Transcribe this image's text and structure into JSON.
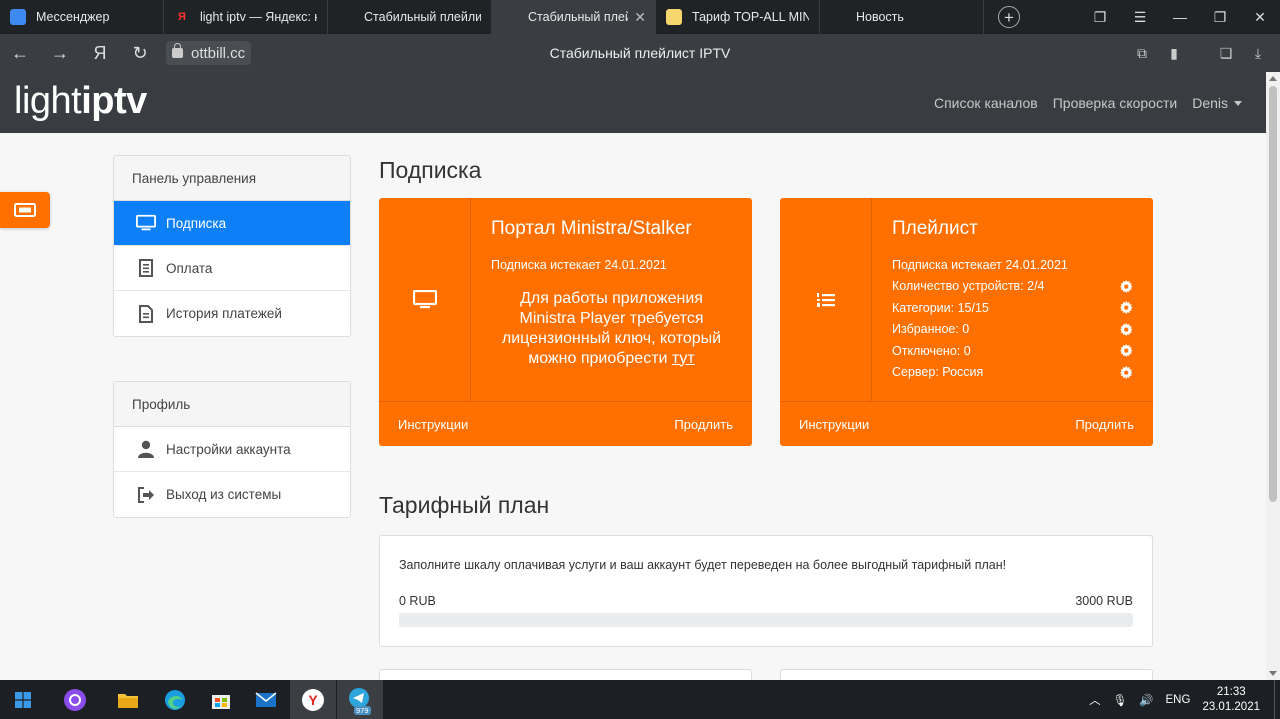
{
  "browser": {
    "tabs": [
      {
        "title": "Мессенджер",
        "active": false,
        "fav_color": "#3d8bf2",
        "fav_text": ""
      },
      {
        "title": "light iptv — Яндекс: на",
        "active": false,
        "fav_color": "#1f2326",
        "fav_text": "Я"
      },
      {
        "title": "Стабильный плейлист",
        "active": false,
        "fav_color": "#1f2326",
        "fav_text": ""
      },
      {
        "title": "Стабильный плейлис",
        "active": true,
        "fav_color": "#3a3e42",
        "fav_text": ""
      },
      {
        "title": "Тариф TOP-ALL MINU",
        "active": false,
        "fav_color": "#f5d76e",
        "fav_text": ""
      },
      {
        "title": "Новость",
        "active": false,
        "fav_color": "#1f2326",
        "fav_text": ""
      }
    ],
    "tab_close": "✕",
    "url": "ottbill.cc",
    "page_title": "Стабильный плейлист IPTV",
    "nav": {
      "back": "←",
      "forward": "→",
      "yandex": "Я",
      "reload": "↻"
    }
  },
  "header": {
    "logo_light": "light",
    "logo_iptv": "iptv",
    "nav": [
      {
        "label": "Список каналов"
      },
      {
        "label": "Проверка скорости"
      },
      {
        "label": "Denis"
      }
    ]
  },
  "sidebar": {
    "control": {
      "title": "Панель управления",
      "items": [
        {
          "label": "Подписка",
          "icon": "monitor-icon",
          "active": true
        },
        {
          "label": "Оплата",
          "icon": "receipt-icon",
          "active": false
        },
        {
          "label": "История платежей",
          "icon": "document-icon",
          "active": false
        }
      ]
    },
    "profile": {
      "title": "Профиль",
      "items": [
        {
          "label": "Настройки аккаунта",
          "icon": "user-icon"
        },
        {
          "label": "Выход из системы",
          "icon": "sign-out-icon"
        }
      ]
    }
  },
  "main": {
    "subscription_title": "Подписка",
    "portal_card": {
      "title": "Портал Ministra/Stalker",
      "expires": "Подписка истекает 24.01.2021",
      "message_lines": [
        "Для работы приложения",
        "Ministra Player требуется",
        "лицензионный ключ, который"
      ],
      "message_last": "можно приобрести",
      "message_link": "тут",
      "instructions": "Инструкции",
      "renew": "Продлить"
    },
    "playlist_card": {
      "title": "Плейлист",
      "expires": "Подписка истекает 24.01.2021",
      "rows": [
        {
          "label": "Количество устройств: 2/4"
        },
        {
          "label": "Категории: 15/15"
        },
        {
          "label": "Избранное: 0"
        },
        {
          "label": "Отключено: 0"
        },
        {
          "label": "Сервер: Россия"
        }
      ],
      "instructions": "Инструкции",
      "renew": "Продлить"
    },
    "plan_title": "Тарифный план",
    "plan": {
      "text": "Заполните шкалу оплачивая услуги и ваш аккаунт будет переведен на более выгодный тарифный план!",
      "min": "0 RUB",
      "max": "3000 RUB",
      "progress_fraction": 0
    }
  },
  "taskbar": {
    "lang": "ENG",
    "time": "21:33",
    "date": "23.01.2021",
    "telegram_badge": "979"
  },
  "colors": {
    "accent": "#ff7000",
    "active_blue": "#0d7ff7",
    "header_bg": "#393c40"
  }
}
